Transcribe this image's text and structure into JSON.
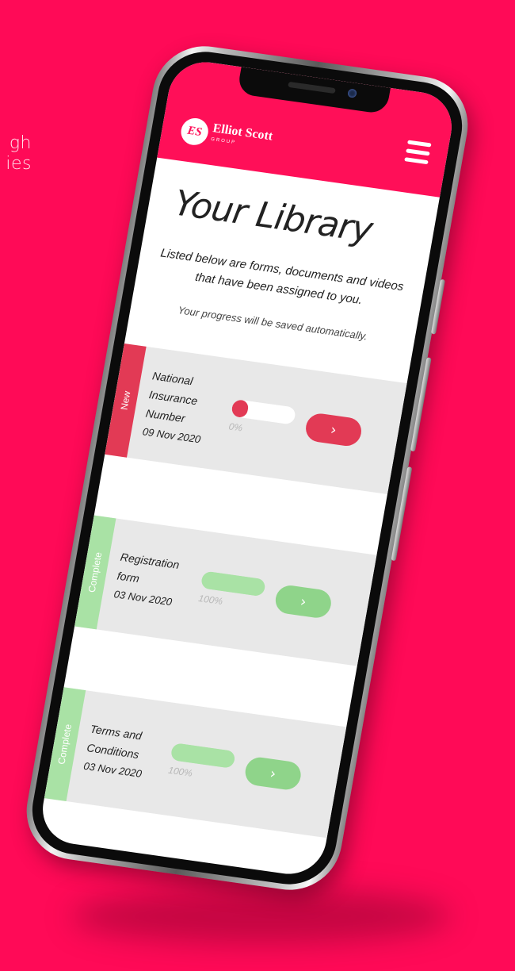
{
  "background_text": {
    "line1": "gh",
    "line2": "ies"
  },
  "app": {
    "brand": {
      "badge": "ES",
      "name": "Elliot Scott",
      "sub": "GROUP"
    },
    "menu_icon": "hamburger-menu-icon",
    "title": "Your Library",
    "intro": "Listed below are forms, documents and videos that have been assigned to you.",
    "progress_note": "Your progress will be saved automatically.",
    "action_icon": "chevron-right-icon"
  },
  "documents": [
    {
      "status": "New",
      "name_lines": [
        "National",
        "Insurance",
        "Number"
      ],
      "date": "09 Nov 2020",
      "progress_label": "0%",
      "progress": 0.25,
      "action": "›"
    },
    {
      "status": "Complete",
      "name_lines": [
        "Registration",
        "form"
      ],
      "date": "03 Nov 2020",
      "progress_label": "100%",
      "progress": 1.0,
      "action": "›"
    },
    {
      "status": "Complete",
      "name_lines": [
        "Terms and",
        "Conditions"
      ],
      "date": "03 Nov 2020",
      "progress_label": "100%",
      "progress": 1.0,
      "action": "›"
    }
  ],
  "colors": {
    "background": "#ff0a57",
    "appbar": "#ff0f58",
    "new": "#e23a55",
    "complete": "#a9e2a5",
    "complete_button": "#8fd48a",
    "card": "#e8e8e8"
  }
}
